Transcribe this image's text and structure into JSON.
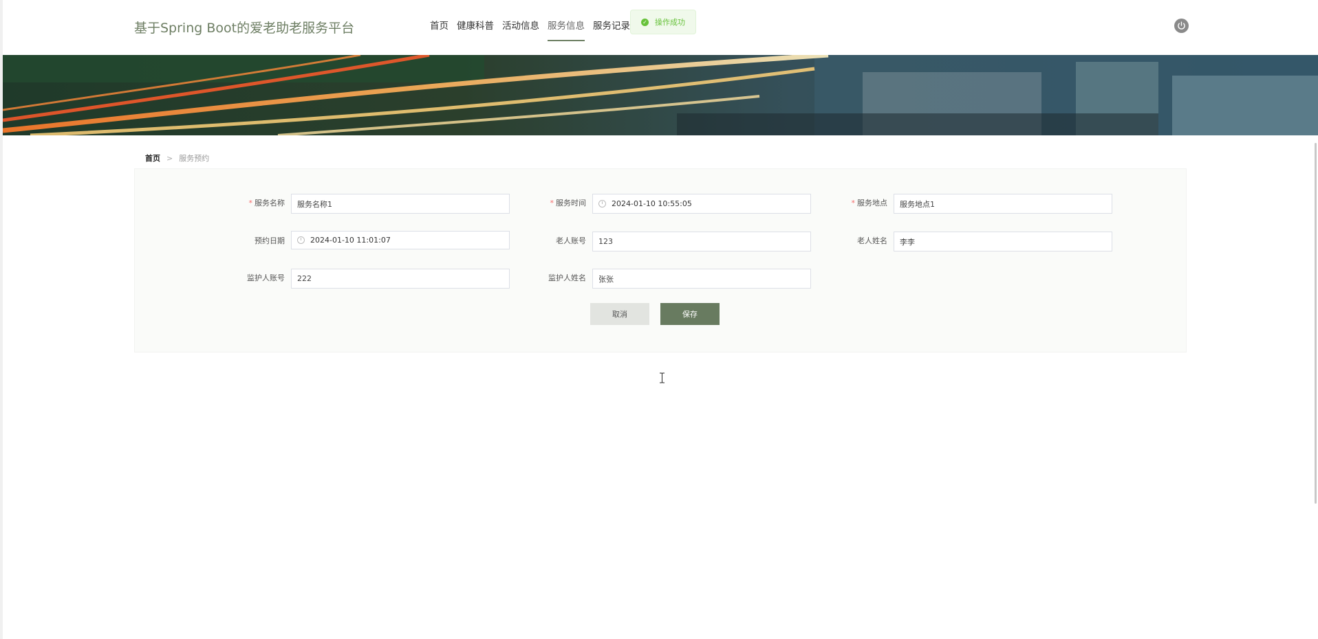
{
  "header": {
    "site_title": "基于Spring Boot的爱老助老服务平台",
    "nav": [
      {
        "label": "首页"
      },
      {
        "label": "健康科普"
      },
      {
        "label": "活动信息"
      },
      {
        "label": "服务信息",
        "active": true
      },
      {
        "label": "服务记录"
      }
    ],
    "toast": {
      "text": "操作成功"
    }
  },
  "breadcrumb": {
    "home": "首页",
    "separator": ">",
    "current": "服务预约"
  },
  "form": {
    "fields": {
      "service_name": {
        "label": "服务名称",
        "value": "服务名称1",
        "required": true
      },
      "service_time": {
        "label": "服务时间",
        "value": "2024-01-10 10:55:05",
        "required": true
      },
      "service_location": {
        "label": "服务地点",
        "value": "服务地点1",
        "required": true
      },
      "booking_date": {
        "label": "预约日期",
        "value": "2024-01-10 11:01:07",
        "required": false
      },
      "elder_account": {
        "label": "老人账号",
        "value": "123",
        "required": false
      },
      "elder_name": {
        "label": "老人姓名",
        "value": "李李",
        "required": false
      },
      "guardian_account": {
        "label": "监护人账号",
        "value": "222",
        "required": false
      },
      "guardian_name": {
        "label": "监护人姓名",
        "value": "张张",
        "required": false
      }
    },
    "required_mark": "*",
    "cancel_label": "取消",
    "save_label": "保存"
  },
  "colors": {
    "accent": "#687b60",
    "title": "#6d7e63",
    "success": "#67c23a",
    "required": "#f56c6c"
  }
}
